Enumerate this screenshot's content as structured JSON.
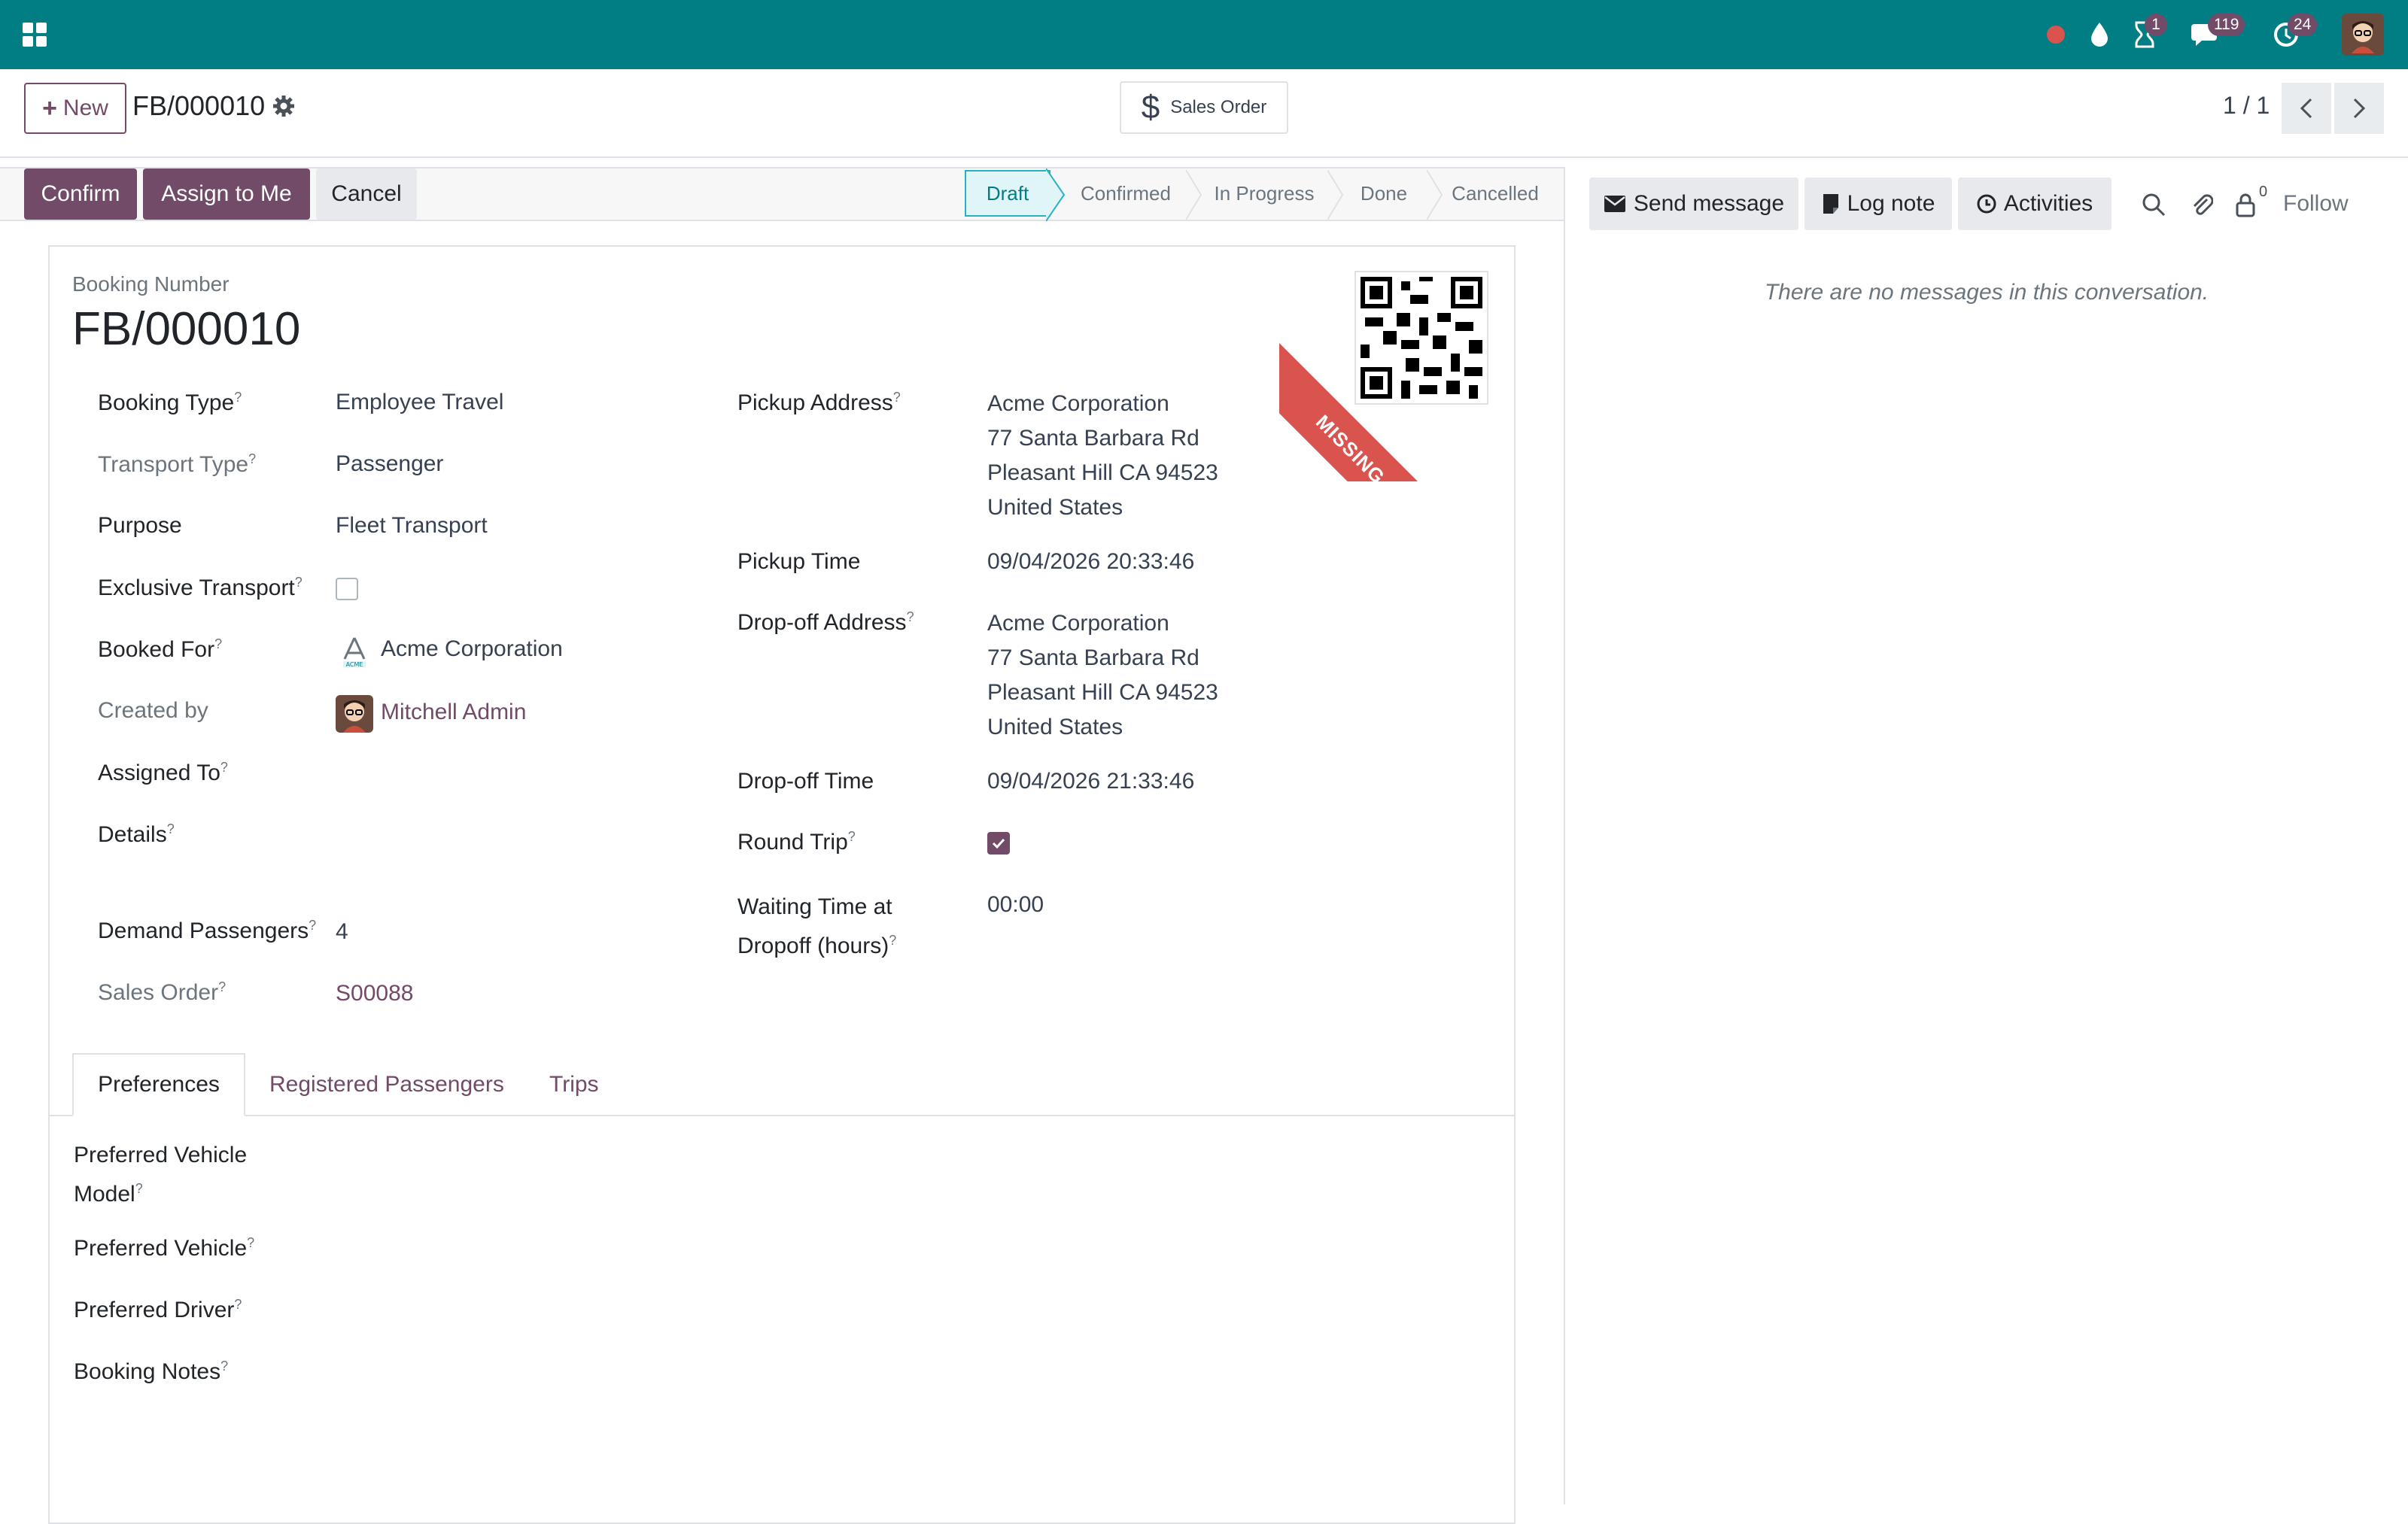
{
  "navbar": {
    "apps_icon": "grid-icon",
    "badges": {
      "activities": "1",
      "messages": "119",
      "updates": "24"
    }
  },
  "control_panel": {
    "new_label": "New",
    "record_title": "FB/000010",
    "smart_button": "Sales Order",
    "pager": "1 / 1"
  },
  "statusbar": {
    "buttons": [
      "Confirm",
      "Assign to Me",
      "Cancel"
    ],
    "stages": [
      "Draft",
      "Confirmed",
      "In Progress",
      "Done",
      "Cancelled"
    ],
    "active_stage": "Draft"
  },
  "ribbon": "MISSING APPROVAL",
  "form": {
    "booking_number_label": "Booking Number",
    "booking_number": "FB/000010",
    "left": {
      "booking_type": {
        "label": "Booking Type",
        "value": "Employee Travel"
      },
      "transport_type": {
        "label": "Transport Type",
        "value": "Passenger"
      },
      "purpose": {
        "label": "Purpose",
        "value": "Fleet Transport"
      },
      "exclusive_transport": {
        "label": "Exclusive Transport",
        "checked": false
      },
      "booked_for": {
        "label": "Booked For",
        "value": "Acme Corporation"
      },
      "created_by": {
        "label": "Created by",
        "value": "Mitchell Admin"
      },
      "assigned_to": {
        "label": "Assigned To",
        "value": ""
      },
      "details": {
        "label": "Details",
        "value": ""
      },
      "demand_passengers": {
        "label": "Demand Passengers",
        "value": "4"
      },
      "sales_order": {
        "label": "Sales Order",
        "value": "S00088"
      }
    },
    "right": {
      "pickup_address": {
        "label": "Pickup Address",
        "lines": [
          "Acme Corporation",
          "77 Santa Barbara Rd",
          "Pleasant Hill CA 94523",
          "United States"
        ]
      },
      "pickup_time": {
        "label": "Pickup Time",
        "value": "09/04/2026 20:33:46"
      },
      "dropoff_address": {
        "label": "Drop-off Address",
        "lines": [
          "Acme Corporation",
          "77 Santa Barbara Rd",
          "Pleasant Hill CA 94523",
          "United States"
        ]
      },
      "dropoff_time": {
        "label": "Drop-off Time",
        "value": "09/04/2026 21:33:46"
      },
      "round_trip": {
        "label": "Round Trip",
        "checked": true
      },
      "waiting_time": {
        "label_line1": "Waiting Time at",
        "label_line2": "Dropoff (hours)",
        "value": "00:00"
      }
    },
    "tooltip_marker": "?"
  },
  "tabs": [
    "Preferences",
    "Registered Passengers",
    "Trips"
  ],
  "preferences": {
    "vehicle_model_line1": "Preferred Vehicle",
    "vehicle_model_line2": "Model",
    "vehicle": "Preferred Vehicle",
    "driver": "Preferred Driver",
    "notes": "Booking Notes"
  },
  "chatter": {
    "send_message": "Send message",
    "log_note": "Log note",
    "activities": "Activities",
    "followers_count": "0",
    "follow": "Follow",
    "empty_message": "There are no messages in this conversation."
  },
  "colors": {
    "navbar": "#017e84",
    "primary": "#714b67",
    "ribbon": "#d9534f",
    "active_stage": "#e0f5f7"
  }
}
